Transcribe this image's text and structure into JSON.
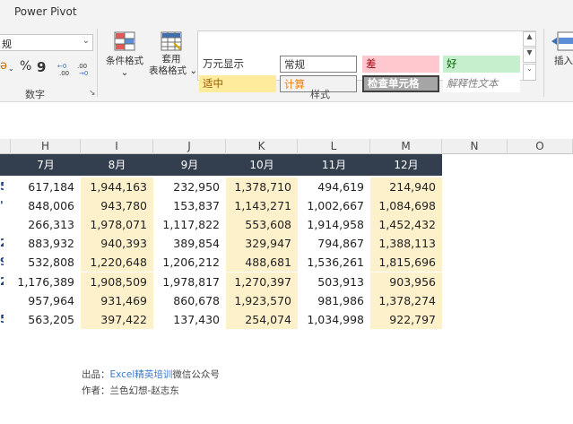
{
  "ribbon": {
    "tab": "Power Pivot",
    "number_format": "规",
    "number_group_label": "数字",
    "percent_symbol": "%",
    "comma_symbol": "9",
    "currency_symbol": "ə",
    "inc_decimal": "←0 .00",
    "dec_decimal": ".00 →0",
    "conditional_format": "条件格式",
    "format_as_table": [
      "套用",
      "表格格式"
    ],
    "styles_group_label": "样式",
    "insert_label": "插入",
    "styles": [
      {
        "label": "万元显示",
        "bg": "#ffffff",
        "fg": "#333333"
      },
      {
        "label": "常规",
        "bg": "#ffffff",
        "fg": "#333333"
      },
      {
        "label": "差",
        "bg": "#ffc7ce",
        "fg": "#9c0006"
      },
      {
        "label": "好",
        "bg": "#c6efce",
        "fg": "#006100"
      },
      {
        "label": "适中",
        "bg": "#ffeb9c",
        "fg": "#9c5700"
      },
      {
        "label": "计算",
        "bg": "#f2f2f2",
        "fg": "#fa7d00"
      },
      {
        "label": "检查单元格",
        "bg": "#a5a5a5",
        "fg": "#ffffff"
      },
      {
        "label": "解释性文本",
        "bg": "#ffffff",
        "fg": "#7f7f7f"
      }
    ]
  },
  "columns": [
    "H",
    "I",
    "J",
    "K",
    "L",
    "M",
    "N",
    "O"
  ],
  "table": {
    "headers": [
      "7月",
      "8月",
      "9月",
      "10月",
      "11月",
      "12月"
    ],
    "edge_marks": [
      "5",
      "'",
      "",
      "2",
      "9",
      "2",
      "",
      "5"
    ],
    "rows": [
      [
        "617,184",
        "1,944,163",
        "232,950",
        "1,378,710",
        "494,619",
        "214,940"
      ],
      [
        "848,006",
        "943,780",
        "153,837",
        "1,143,271",
        "1,002,667",
        "1,084,698"
      ],
      [
        "266,313",
        "1,978,071",
        "1,117,822",
        "553,608",
        "1,914,958",
        "1,452,432"
      ],
      [
        "883,932",
        "940,393",
        "389,854",
        "329,947",
        "794,867",
        "1,388,113"
      ],
      [
        "532,808",
        "1,220,648",
        "1,206,212",
        "488,681",
        "1,536,261",
        "1,815,696"
      ],
      [
        "1,176,389",
        "1,908,509",
        "1,978,817",
        "1,270,397",
        "503,913",
        "903,956"
      ],
      [
        "957,964",
        "931,469",
        "860,678",
        "1,923,570",
        "981,986",
        "1,378,274"
      ],
      [
        "563,205",
        "397,422",
        "137,430",
        "254,074",
        "1,034,998",
        "922,797"
      ]
    ]
  },
  "credits": {
    "source_label": "出品：",
    "source_link": "Excel精英培训",
    "source_suffix": "微信公众号",
    "author_label": "作者：",
    "author": "兰色幻想-赵志东"
  }
}
